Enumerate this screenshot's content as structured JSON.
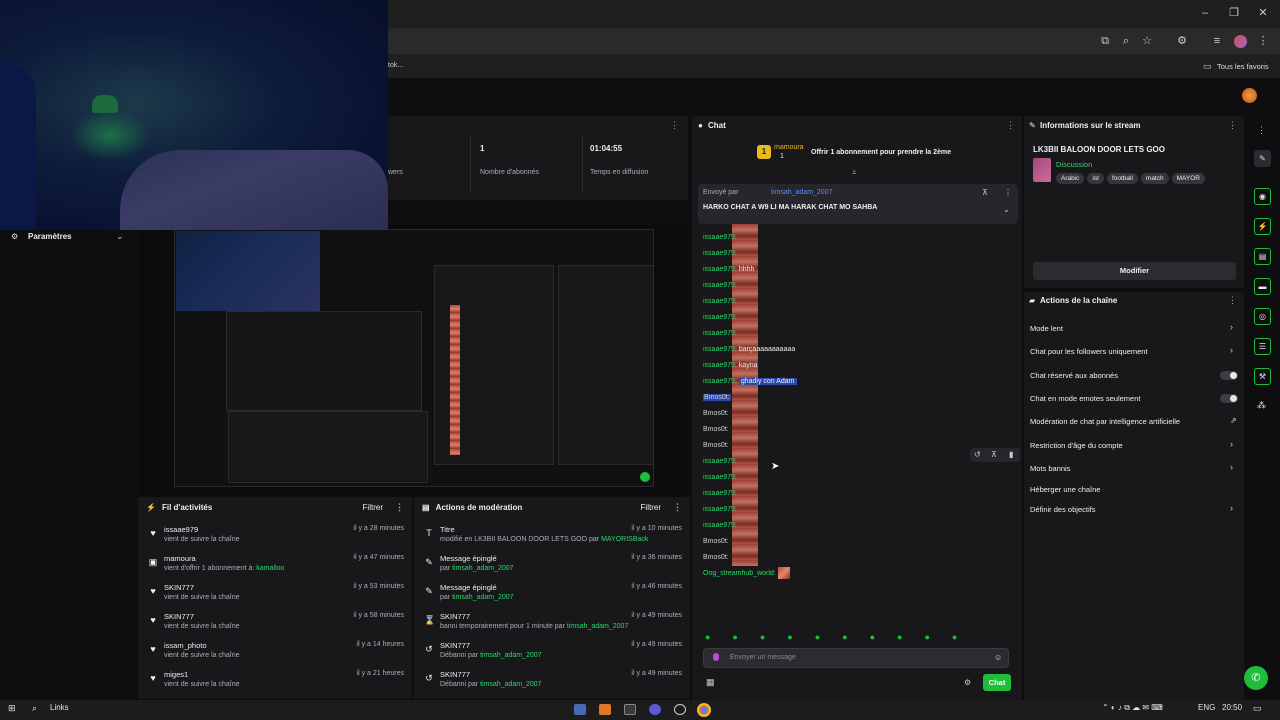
{
  "browser": {
    "address_fragment": "tok...",
    "bookmarks_label": "Tous les favoris"
  },
  "stats": {
    "viewers_label": "wers",
    "subs_value": "1",
    "subs_label": "Nombre d'abonnés",
    "time_value": "01:04:55",
    "time_label": "Temps en diffusion"
  },
  "sidebar": {
    "settings_label": "Paramètres"
  },
  "activity": {
    "title": "Fil d'activités",
    "filter": "Filtrer",
    "items": [
      {
        "name": "issaae979",
        "sub": "vient de suivre la chaîne",
        "time": "il y a 28 minutes",
        "icon": "heart-icon"
      },
      {
        "name": "mamoura",
        "sub": "vient d'offrir 1 abonnement à:",
        "sub_extra": "kamalloo",
        "time": "il y a 47 minutes",
        "icon": "gift-icon"
      },
      {
        "name": "SKIN777",
        "sub": "vient de suivre la chaîne",
        "time": "il y a 53 minutes",
        "icon": "heart-icon"
      },
      {
        "name": "SKIN777",
        "sub": "vient de suivre la chaîne",
        "time": "il y a 58 minutes",
        "icon": "heart-icon"
      },
      {
        "name": "issam_photo",
        "sub": "vient de suivre la chaîne",
        "time": "il y a 14 heures",
        "icon": "heart-icon"
      },
      {
        "name": "miges1",
        "sub": "vient de suivre la chaîne",
        "time": "il y a 21 heures",
        "icon": "heart-icon"
      }
    ]
  },
  "moderation": {
    "title": "Actions de modération",
    "filter": "Filtrer",
    "items": [
      {
        "name": "Titre",
        "sub": "modifié en LK3BII BALOON DOOR LETS GOO par",
        "by": "MAYORISBack",
        "time": "il y a 10 minutes"
      },
      {
        "name": "Message épinglé",
        "sub": "par",
        "by": "timsah_adam_2007",
        "time": "il y a 36 minutes"
      },
      {
        "name": "Message épinglé",
        "sub": "par",
        "by": "timsah_adam_2007",
        "time": "il y a 46 minutes"
      },
      {
        "name": "SKIN777",
        "sub": "banni temporairement pour 1 minute par",
        "by": "timsah_adam_2007",
        "time": "il y a 49 minutes"
      },
      {
        "name": "SKIN777",
        "sub": "Débanni par",
        "by": "timsah_adam_2007",
        "time": "il y a 49 minutes"
      },
      {
        "name": "SKIN777",
        "sub": "Débanni par",
        "by": "timsah_adam_2007",
        "time": "il y a 49 minutes"
      }
    ]
  },
  "chat": {
    "title": "Chat",
    "gift_user": "mamoura",
    "gift_count": "1",
    "gift_text": "Offrir 1 abonnement pour prendre la 2ème",
    "pinned_label": "Envoyé par",
    "pinned_user": "timsah_adam_2007",
    "pinned_text": "HARKO CHAT A W9 LI MA HARAK CHAT MO SAHBA",
    "lines": [
      {
        "user": "issaae979:",
        "text": ""
      },
      {
        "user": "issaae979:",
        "text": ""
      },
      {
        "user": "issaae979:",
        "text": "hhhh"
      },
      {
        "user": "issaae979:",
        "text": ""
      },
      {
        "user": "issaae979:",
        "text": ""
      },
      {
        "user": "issaae979:",
        "text": ""
      },
      {
        "user": "issaae979:",
        "text": ""
      },
      {
        "user": "issaae979:",
        "text": "barçaaaaaaaaaaa"
      },
      {
        "user": "issaae979:",
        "text": "kayna"
      },
      {
        "user": "issaae979:",
        "text": "ghadiy con Adam"
      },
      {
        "user": "Bmos0t:",
        "text": ""
      },
      {
        "user": "Bmos0t:",
        "text": ""
      },
      {
        "user": "Bmos0t:",
        "text": ""
      },
      {
        "user": "Bmos0t:",
        "text": ""
      },
      {
        "user": "issaae979:",
        "text": ""
      },
      {
        "user": "issaae979:",
        "text": ""
      },
      {
        "user": "issaae979:",
        "text": ""
      },
      {
        "user": "issaae979:",
        "text": ""
      },
      {
        "user": "issaae979:",
        "text": ""
      },
      {
        "user": "Bmos0t:",
        "text": ""
      },
      {
        "user": "Bmos0t:",
        "text": ""
      }
    ],
    "last_user": "Oog_streamhub_world:",
    "input_placeholder": "Envoyer un message",
    "send_label": "Chat"
  },
  "stream_info": {
    "title": "Informations sur le stream",
    "stream_title": "LK3BII BALOON DOOR LETS GOO",
    "category": "Discussion",
    "tags": [
      "Arabic",
      "ist",
      "football",
      "match",
      "MAYOR"
    ],
    "edit_label": "Modifier"
  },
  "channel_actions": {
    "title": "Actions de la chaîne",
    "items": [
      {
        "label": "Mode lent",
        "control": "chevron"
      },
      {
        "label": "Chat pour les followers uniquement",
        "control": "chevron"
      },
      {
        "label": "Chat réservé aux abonnés",
        "control": "toggle"
      },
      {
        "label": "Chat en mode emotes seulement",
        "control": "toggle"
      },
      {
        "label": "Modération de chat par intelligence artificielle",
        "control": "external"
      },
      {
        "label": "Restriction d'âge du compte",
        "control": "chevron"
      },
      {
        "label": "Mots bannis",
        "control": "chevron"
      },
      {
        "label": "Héberger une chaîne",
        "control": "none"
      },
      {
        "label": "Définir des objectifs",
        "control": "chevron"
      }
    ]
  },
  "taskbar": {
    "search_label": "Links",
    "lang": "ENG",
    "time": "20:50"
  }
}
